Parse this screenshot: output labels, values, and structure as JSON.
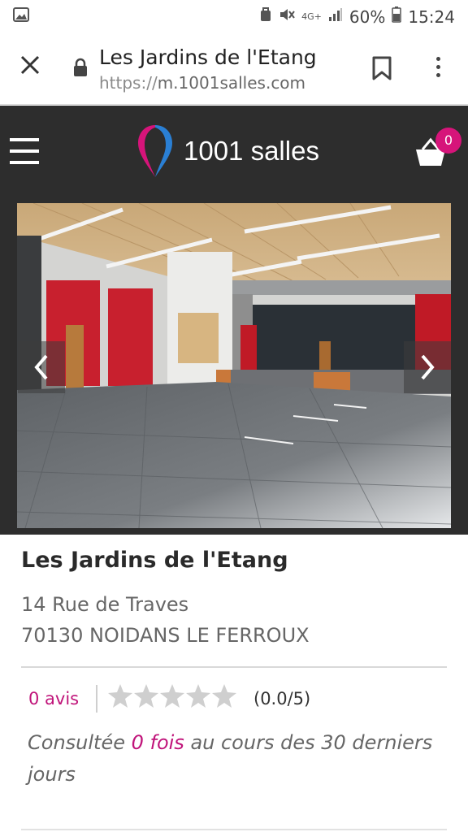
{
  "status_bar": {
    "signal_label": "4G+",
    "battery": "60%",
    "time": "15:24"
  },
  "browser": {
    "page_title": "Les Jardins de l'Etang",
    "url_protocol": "https://",
    "url_host": "m.1001salles.com"
  },
  "site_header": {
    "logo_text": "1001 salles",
    "cart_count": "0",
    "brand_colors": {
      "pink": "#d6147a",
      "blue": "#2a7fd4",
      "dark": "#2d2d2d"
    }
  },
  "gallery": {
    "prev_symbol": "‹",
    "next_symbol": "›"
  },
  "venue": {
    "name": "Les Jardins de l'Etang",
    "street": "14 Rue de Traves",
    "city": "70130 NOIDANS LE FERROUX",
    "reviews_label": "0 avis",
    "rating_stars": 0,
    "rating_text": "(0.0/5)",
    "views_prefix": "Consultée ",
    "views_count": "0 fois",
    "views_suffix": " au cours des 30 derniers jours"
  },
  "icons": [
    "image-icon",
    "hand-icon",
    "mute-icon",
    "signal-icon",
    "battery-icon",
    "close-icon",
    "lock-icon",
    "bookmark-icon",
    "more-vert-icon",
    "hamburger-icon",
    "location-pin-logo-icon",
    "basket-icon",
    "chevron-left-icon",
    "chevron-right-icon",
    "star-icon"
  ]
}
